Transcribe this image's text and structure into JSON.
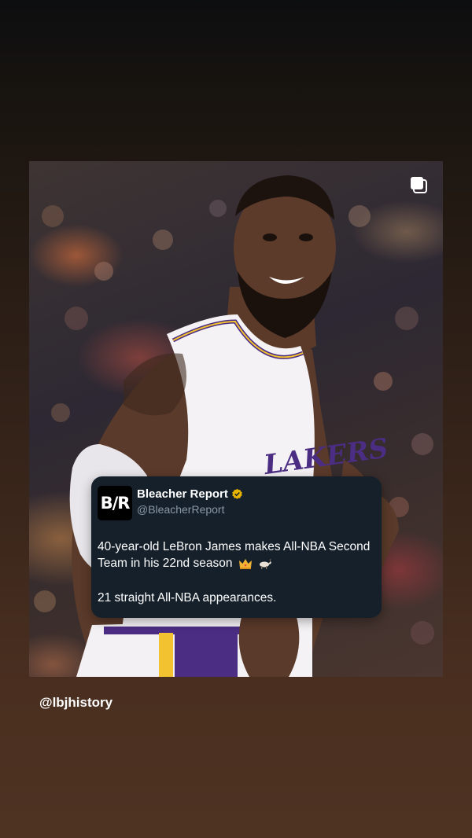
{
  "post": {
    "tweet": {
      "logo_text": "B/R",
      "account_name": "Bleacher Report",
      "handle": "@BleacherReport",
      "text": "40-year-old LeBron James makes All-NBA Second Team in his 22nd season",
      "text_emojis": [
        "crown-emoji",
        "goat-emoji"
      ],
      "second_line": "21 straight All-NBA appearances.",
      "verified_icon": "verified-badge-icon"
    },
    "photo": {
      "jersey_text": "LAKERS",
      "icon": "multi-post-icon"
    }
  },
  "mention": {
    "username": "@lbjhistory"
  },
  "colors": {
    "tweet_bg": "#15202b",
    "handle": "#8b98a5",
    "verified": "#e8b400",
    "lakers_purple": "#4b2d83",
    "lakers_gold": "#f2c230"
  }
}
